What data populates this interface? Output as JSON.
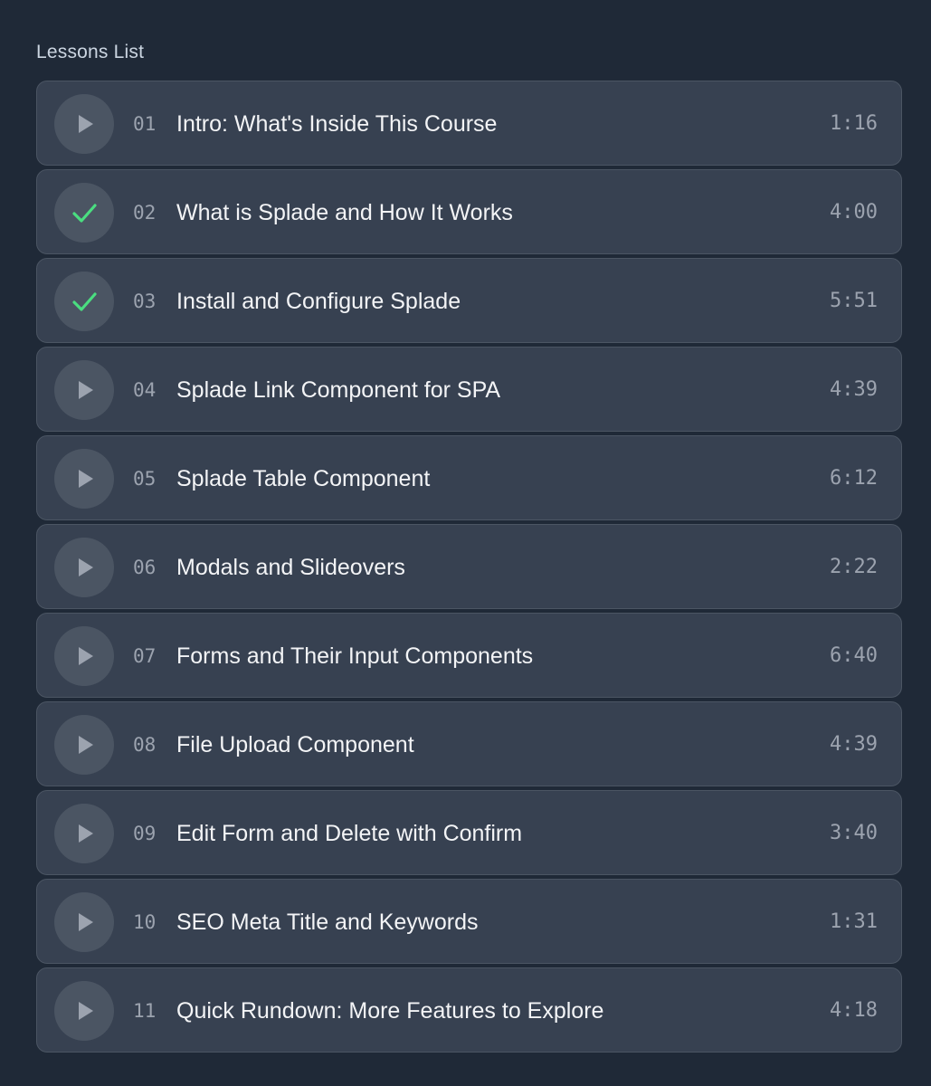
{
  "page": {
    "heading": "Lessons List"
  },
  "colors": {
    "background": "#1f2937",
    "row_background": "#374151",
    "row_border": "#4b5563",
    "icon_circle": "#4b5563",
    "play_icon": "#9ca3af",
    "check_icon": "#4ade80",
    "title_text": "#f3f4f6",
    "muted_text": "#9ca3af"
  },
  "lessons": [
    {
      "number": "01",
      "title": "Intro: What's Inside This Course",
      "duration": "1:16",
      "status": "play-icon"
    },
    {
      "number": "02",
      "title": "What is Splade and How It Works",
      "duration": "4:00",
      "status": "check-icon"
    },
    {
      "number": "03",
      "title": "Install and Configure Splade",
      "duration": "5:51",
      "status": "check-icon"
    },
    {
      "number": "04",
      "title": "Splade Link Component for SPA",
      "duration": "4:39",
      "status": "play-icon"
    },
    {
      "number": "05",
      "title": "Splade Table Component",
      "duration": "6:12",
      "status": "play-icon"
    },
    {
      "number": "06",
      "title": "Modals and Slideovers",
      "duration": "2:22",
      "status": "play-icon"
    },
    {
      "number": "07",
      "title": "Forms and Their Input Components",
      "duration": "6:40",
      "status": "play-icon"
    },
    {
      "number": "08",
      "title": "File Upload Component",
      "duration": "4:39",
      "status": "play-icon"
    },
    {
      "number": "09",
      "title": "Edit Form and Delete with Confirm",
      "duration": "3:40",
      "status": "play-icon"
    },
    {
      "number": "10",
      "title": "SEO Meta Title and Keywords",
      "duration": "1:31",
      "status": "play-icon"
    },
    {
      "number": "11",
      "title": "Quick Rundown: More Features to Explore",
      "duration": "4:18",
      "status": "play-icon"
    }
  ]
}
